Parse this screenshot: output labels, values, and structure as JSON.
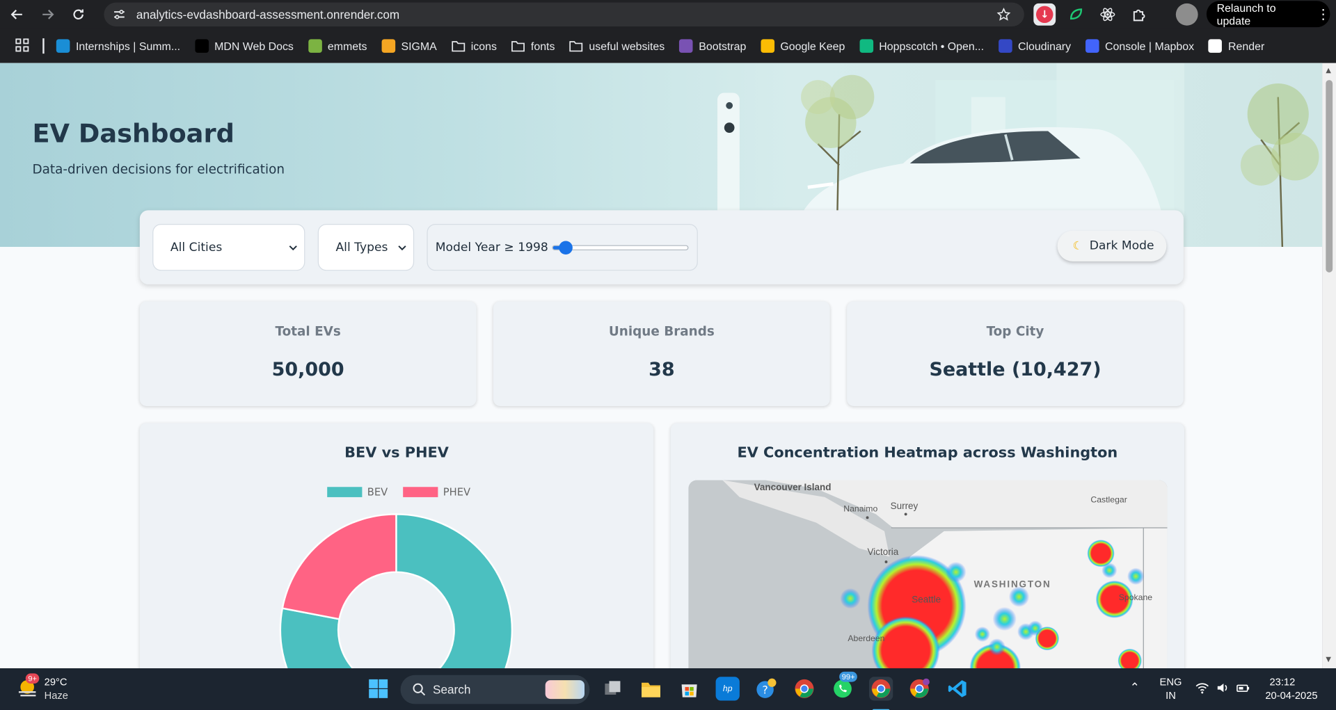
{
  "browser": {
    "url": "analytics-evdashboard-assessment.onrender.com",
    "relaunch_label": "Relaunch to update"
  },
  "bookmarks": [
    {
      "label": "Internships | Summ...",
      "icon": "internshala-icon",
      "color": "#1a8ed6"
    },
    {
      "label": "MDN Web Docs",
      "icon": "mdn-icon",
      "color": "#000000"
    },
    {
      "label": "emmets",
      "icon": "emmet-icon",
      "color": "#7cb342"
    },
    {
      "label": "SIGMA",
      "icon": "sigma-icon",
      "color": "#f5a623"
    },
    {
      "label": "icons",
      "icon": "folder-icon",
      "color": "#e8eaed"
    },
    {
      "label": "fonts",
      "icon": "folder-icon",
      "color": "#e8eaed"
    },
    {
      "label": "useful websites",
      "icon": "folder-icon",
      "color": "#e8eaed"
    },
    {
      "label": "Bootstrap",
      "icon": "bootstrap-icon",
      "color": "#7952b3"
    },
    {
      "label": "Google Keep",
      "icon": "keep-icon",
      "color": "#fbbc04"
    },
    {
      "label": "Hoppscotch • Open...",
      "icon": "hoppscotch-icon",
      "color": "#10b981"
    },
    {
      "label": "Cloudinary",
      "icon": "cloudinary-icon",
      "color": "#3448c5"
    },
    {
      "label": "Console | Mapbox",
      "icon": "mapbox-icon",
      "color": "#4264fb"
    },
    {
      "label": "Render",
      "icon": "render-icon",
      "color": "#ffffff"
    }
  ],
  "hero": {
    "title": "EV Dashboard",
    "subtitle": "Data-driven decisions for electrification"
  },
  "filters": {
    "city": "All Cities",
    "type": "All Types",
    "year_label": "Model Year ≥ 1998",
    "year_min": 1997,
    "year_max": 2025,
    "year_value": 1998,
    "dark_mode_label": "Dark Mode"
  },
  "stats": {
    "total_label": "Total EVs",
    "total_value": "50,000",
    "brands_label": "Unique Brands",
    "brands_value": "38",
    "city_label": "Top City",
    "city_value": "Seattle (10,427)"
  },
  "bev_panel": {
    "title": "BEV vs PHEV"
  },
  "map_panel": {
    "title": "EV Concentration Heatmap across Washington",
    "labels": {
      "vancouver": "Vancouver Island",
      "nanaimo": "Nanaimo",
      "surrey": "Surrey",
      "castlegar": "Castlegar",
      "victoria": "Victoria",
      "washington": "WASHINGTON",
      "seattle": "Seattle",
      "spokane": "Spokane",
      "aberdeen": "Aberdeen"
    }
  },
  "chart_data": {
    "type": "pie",
    "categories": [
      "BEV",
      "PHEV"
    ],
    "values": [
      78,
      22
    ],
    "colors": [
      "#4bc0c0",
      "#ff6384"
    ],
    "legend": "top"
  },
  "taskbar": {
    "weather_temp": "29°C",
    "weather_text": "Haze",
    "weather_badge": "9+",
    "search_placeholder": "Search",
    "whatsapp_badge": "99+",
    "lang1": "ENG",
    "lang2": "IN",
    "time": "23:12",
    "date": "20-04-2025"
  }
}
